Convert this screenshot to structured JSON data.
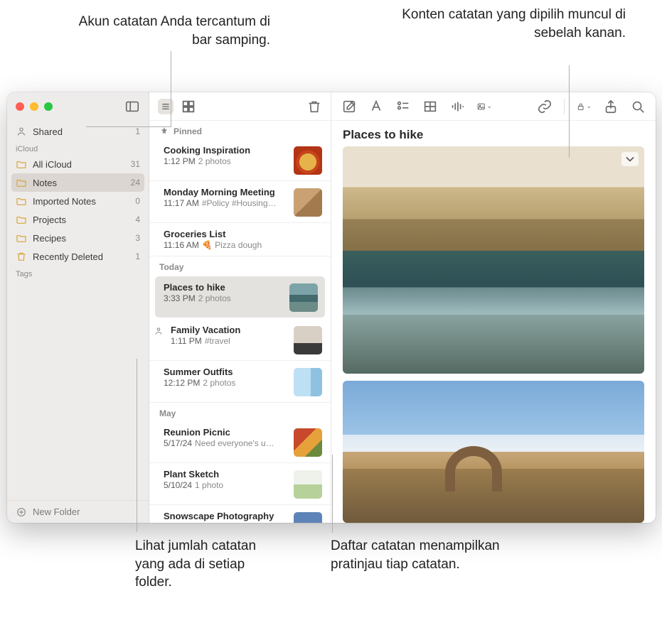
{
  "callouts": {
    "top_left": "Akun catatan Anda tercantum di bar samping.",
    "top_right": "Konten catatan yang dipilih muncul di sebelah kanan.",
    "bottom_left": "Lihat jumlah catatan yang ada di setiap folder.",
    "bottom_right": "Daftar catatan menampilkan pratinjau tiap catatan."
  },
  "sidebar": {
    "shared": {
      "label": "Shared",
      "count": "1"
    },
    "section1": "iCloud",
    "items": [
      {
        "label": "All iCloud",
        "count": "31"
      },
      {
        "label": "Notes",
        "count": "24"
      },
      {
        "label": "Imported Notes",
        "count": "0"
      },
      {
        "label": "Projects",
        "count": "4"
      },
      {
        "label": "Recipes",
        "count": "3"
      },
      {
        "label": "Recently Deleted",
        "count": "1"
      }
    ],
    "section2": "Tags",
    "new_folder": "New Folder"
  },
  "notelist": {
    "sections": {
      "pinned": "Pinned",
      "today": "Today",
      "may": "May"
    },
    "pinned": [
      {
        "title": "Cooking Inspiration",
        "time": "1:12 PM",
        "sub": "2 photos",
        "thumb": "th-pizza"
      },
      {
        "title": "Monday Morning Meeting",
        "time": "11:17 AM",
        "sub": "#Policy #Housing…",
        "thumb": "th-meeting"
      },
      {
        "title": "Groceries List",
        "time": "11:16 AM",
        "sub": "🍕 Pizza dough",
        "thumb": ""
      }
    ],
    "today": [
      {
        "title": "Places to hike",
        "time": "3:33 PM",
        "sub": "2 photos",
        "thumb": "th-hike",
        "selected": true
      },
      {
        "title": "Family Vacation",
        "time": "1:11 PM",
        "sub": "#travel",
        "thumb": "th-bike",
        "shared": true
      },
      {
        "title": "Summer Outfits",
        "time": "12:12 PM",
        "sub": "2 photos",
        "thumb": "th-outfit"
      }
    ],
    "may": [
      {
        "title": "Reunion Picnic",
        "time": "5/17/24",
        "sub": "Need everyone's u…",
        "thumb": "th-picnic"
      },
      {
        "title": "Plant Sketch",
        "time": "5/10/24",
        "sub": "1 photo",
        "thumb": "th-plant"
      },
      {
        "title": "Snowscape Photography",
        "time": "",
        "sub": "",
        "thumb": "th-snow"
      }
    ]
  },
  "editor": {
    "title": "Places to hike"
  }
}
